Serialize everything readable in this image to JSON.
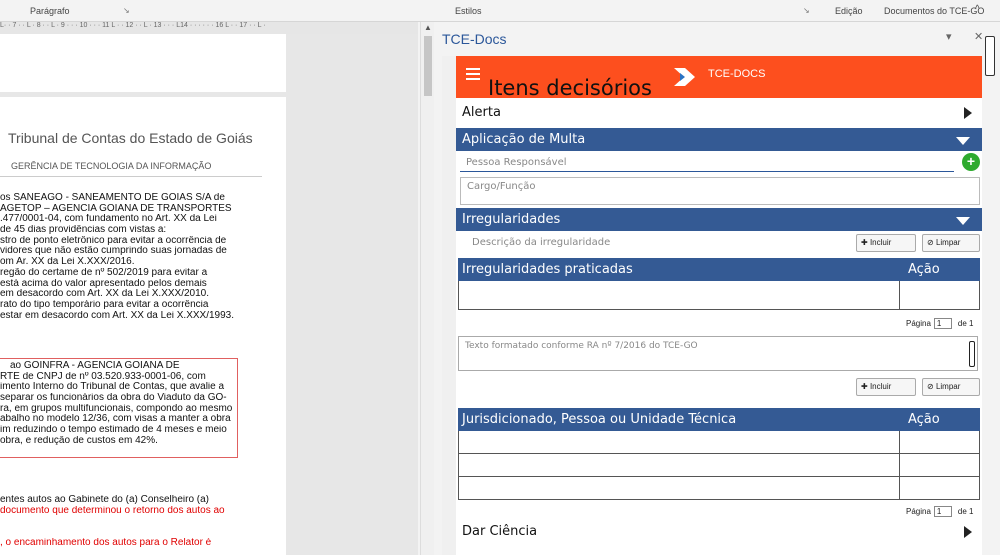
{
  "ribbon": {
    "paragrafo": "Parágrafo",
    "estilos": "Estilos",
    "edicao": "Edição",
    "documentos": "Documentos do TCE-GO"
  },
  "ruler_text": "L· · 7 · · L · 8 · · L · 9 · · · 10 · · · 11 L · · 12 · · L · 13 · · · L14 · · · · · · 16 L · · 17 · · L ·",
  "document": {
    "title": "Tribunal de Contas do Estado de Goiás",
    "subtitle": "GERÊNCIA DE TECNOLOGIA DA INFORMAÇÃO",
    "lines": [
      "os SANEAGO - SANEAMENTO DE GOIÁS S/A de",
      "AGETOP – AGÊNCIA GOIANA DE TRANSPORTES",
      ".477/0001-04, com fundamento no Art. XX da Lei",
      "de 45 dias providências com vistas a:",
      "stro de ponto eletrônico para evitar a ocorrência de",
      "vidores que não estão cumprindo suas jornadas de",
      "om Ar. XX da Lei X.XXX/2016.",
      "regão do certame de nº 502/2019 para evitar a",
      "está acima do valor apresentado pelos demais",
      "em desacordo com Art. XX da Lei X.XXX/2010.",
      "rato do tipo temporário para evitar a ocorrência",
      "estar em desacordo com Art. XX da Lei X.XXX/1993."
    ],
    "boxed_lines": [
      "ao GOINFRA - AGÊNCIA GOIANA DE",
      "RTE de CNPJ de nº 03.520.933-0001-06, com",
      "imento Interno do Tribunal de Contas, que avalie a",
      "separar os funcionários da obra do Viaduto da GO-",
      "ra, em grupos multifuncionais, compondo ao mesmo",
      "abalho no modelo 12/36, com visas a manter a obra",
      "im reduzindo o tempo estimado de 4 meses e meio",
      "obra, e redução de custos em 42%."
    ],
    "tail_lines": [
      "entes autos ao Gabinete do (a) Conselheiro (a)",
      " documento que determinou o retorno dos autos ao",
      "",
      "",
      ", o encaminhamento dos autos para o Relator é"
    ]
  },
  "pane": {
    "title": "TCE-Docs",
    "menu_icon": "chevron-down-icon",
    "close_icon": "close-icon"
  },
  "app": {
    "header_title": "Itens decisórios",
    "logo_text": "TCE-DOCS",
    "accent_color": "#fd4f1e",
    "section_color": "#345a94",
    "sections": {
      "alerta": "Alerta",
      "multa": "Aplicação de Multa",
      "irregularidades": "Irregularidades",
      "dar_ciencia": "Dar Ciência"
    },
    "pessoa_placeholder": "Pessoa Responsável",
    "cargo_placeholder": "Cargo/Função",
    "descricao_placeholder": "Descrição da irregularidade",
    "incluir": "Incluir",
    "limpar": "Limpar",
    "table1": {
      "header": "Irregularidades praticadas",
      "acao": "Ação"
    },
    "pager1": {
      "label": "Página",
      "value": "1",
      "total": "de 1"
    },
    "textarea_placeholder": "Texto formatado conforme RA nº 7/2016 do TCE-GO",
    "table2": {
      "header": "Jurisdicionado, Pessoa ou Unidade Técnica",
      "acao": "Ação"
    },
    "pager2": {
      "label": "Página",
      "value": "1",
      "total": "de 1"
    }
  }
}
